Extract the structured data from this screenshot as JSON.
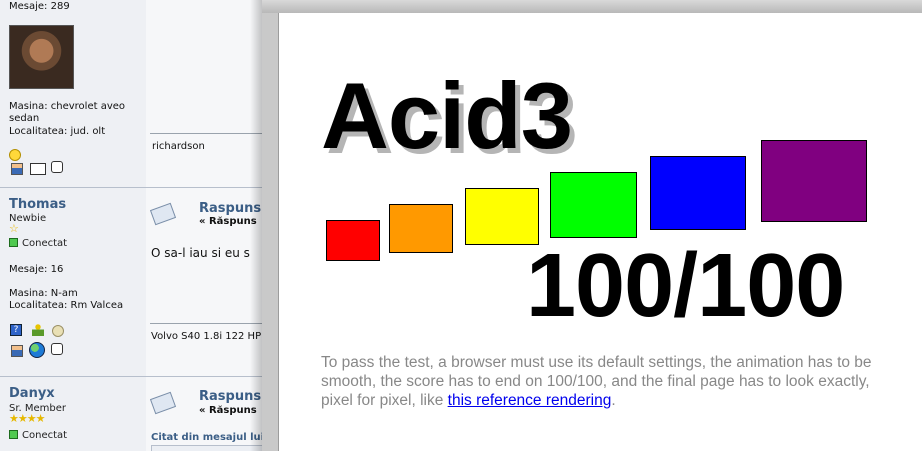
{
  "forum": {
    "top_post": {
      "messages": "Mesaje: 289",
      "car": "Masina: chevrolet aveo sedan",
      "location": "Localitatea: jud. olt",
      "signature": "richardson"
    },
    "post_thomas": {
      "username": "Thomas",
      "rank": "Newbie",
      "status": "Conectat",
      "messages": "Mesaje: 16",
      "car": "Masina: N-am",
      "location": "Localitatea: Rm Valcea",
      "reply_title": "Raspuns",
      "reply_sub": "« Răspuns",
      "body": "O sa-l iau si eu s",
      "signature": "Volvo S40 1.8i 122 HP"
    },
    "post_danyx": {
      "username": "Danyx",
      "rank": "Sr. Member",
      "status": "Conectat",
      "reply_title": "Raspuns",
      "reply_sub": "« Răspuns",
      "quote": "Citat din mesajul lui"
    }
  },
  "acid": {
    "title": "Acid3",
    "score": "100/100",
    "desc_text": "To pass the test, a browser must use its default settings, the animation has to be smooth, the score has to end on 100/100, and the final page has to look exactly, pixel for pixel, like ",
    "link_text": "this reference rendering",
    "desc_end": ".",
    "box_colors": [
      "#ff0000",
      "#ff9900",
      "#ffff00",
      "#00ff00",
      "#0000ff",
      "#800080"
    ]
  },
  "colors": {
    "username": "#3b5e86",
    "link": "#0000ee",
    "desc": "#888888"
  },
  "icons": [
    "smiley-icon",
    "profile-icon",
    "email-icon",
    "message-icon",
    "help-icon",
    "person-icon",
    "globe-icon"
  ]
}
